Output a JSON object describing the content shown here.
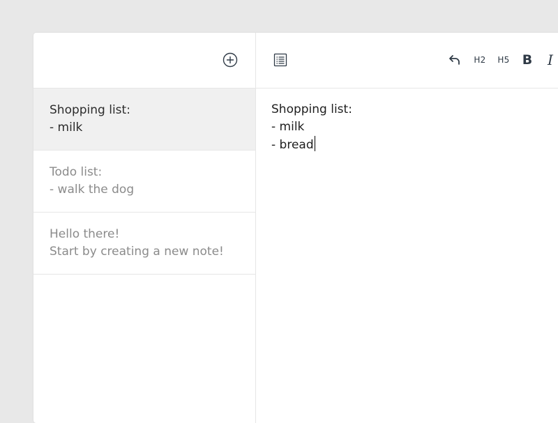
{
  "toolbar": {
    "h2_label": "H2",
    "h5_label": "H5",
    "bold_label": "B",
    "italic_label": "I"
  },
  "notes": [
    {
      "text": "Shopping list:\n- milk",
      "active": true
    },
    {
      "text": "Todo list:\n- walk the dog",
      "active": false
    },
    {
      "text": "Hello there!\nStart by creating a new note!",
      "active": false
    }
  ],
  "editor": {
    "content": "Shopping list:\n- milk\n- bread"
  },
  "icons": {
    "add": "add-circle-icon",
    "list": "list-icon",
    "undo": "undo-icon"
  },
  "colors": {
    "background": "#e8e8e8",
    "active_note": "#f0f0f0",
    "inactive_text": "#8b8b8b",
    "icon": "#2f3a46"
  }
}
